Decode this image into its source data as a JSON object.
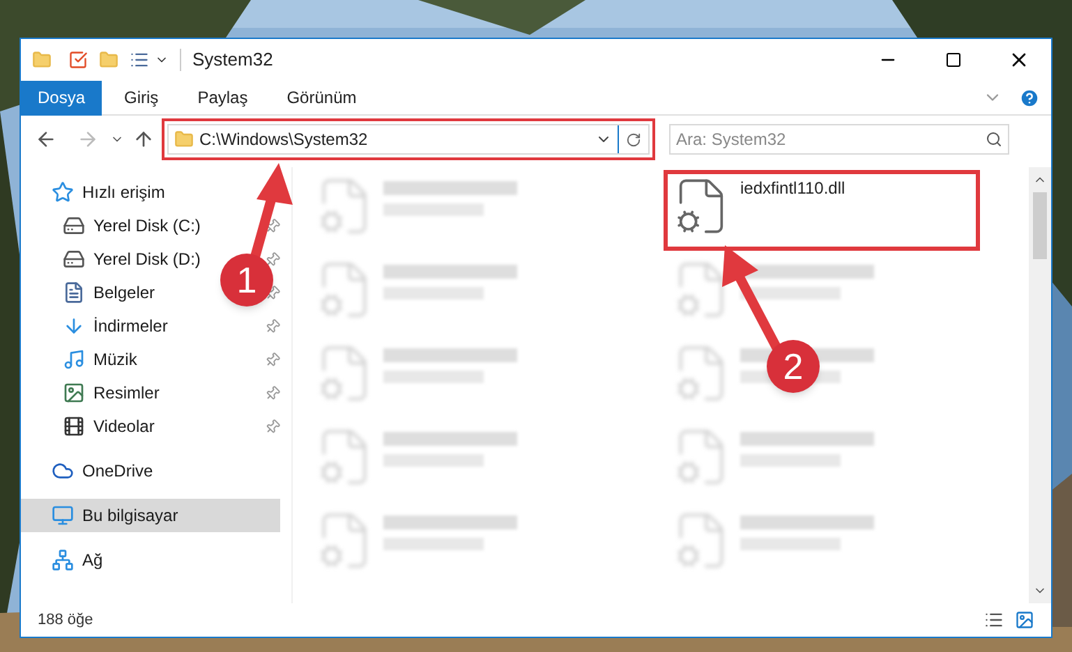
{
  "window": {
    "title": "System32"
  },
  "ribbon_tabs": [
    {
      "label": "Dosya",
      "selected": true
    },
    {
      "label": "Giriş",
      "selected": false
    },
    {
      "label": "Paylaş",
      "selected": false
    },
    {
      "label": "Görünüm",
      "selected": false
    }
  ],
  "address": {
    "path": "C:\\Windows\\System32",
    "highlighted": true
  },
  "search": {
    "placeholder": "Ara: System32"
  },
  "sidebar": {
    "groups": [
      {
        "items": [
          {
            "label": "Hızlı erişim",
            "kind": "star",
            "selected": false,
            "children": [
              {
                "label": "Yerel Disk (C:)",
                "kind": "drive",
                "selected": false,
                "pinned": true
              },
              {
                "label": "Yerel Disk (D:)",
                "kind": "drive",
                "selected": false,
                "pinned": true
              },
              {
                "label": "Belgeler",
                "kind": "documents",
                "selected": false,
                "pinned": true
              },
              {
                "label": "İndirmeler",
                "kind": "downloads",
                "selected": false,
                "pinned": true
              },
              {
                "label": "Müzik",
                "kind": "music",
                "selected": false,
                "pinned": true
              },
              {
                "label": "Resimler",
                "kind": "pictures",
                "selected": false,
                "pinned": true
              },
              {
                "label": "Videolar",
                "kind": "videos",
                "selected": false,
                "pinned": true
              }
            ]
          }
        ]
      },
      {
        "items": [
          {
            "label": "OneDrive",
            "kind": "cloud",
            "selected": false
          }
        ]
      },
      {
        "items": [
          {
            "label": "Bu bilgisayar",
            "kind": "computer",
            "selected": true
          }
        ]
      },
      {
        "items": [
          {
            "label": "Ağ",
            "kind": "network",
            "selected": false
          }
        ]
      }
    ]
  },
  "files": [
    {
      "blurred": true,
      "highlighted": false
    },
    {
      "name": "iedxfintl110.dll",
      "blurred": false,
      "highlighted": true
    },
    {
      "blurred": true,
      "highlighted": false
    },
    {
      "blurred": true,
      "highlighted": false
    },
    {
      "blurred": true,
      "highlighted": false
    },
    {
      "blurred": true,
      "highlighted": false
    },
    {
      "blurred": true,
      "highlighted": false
    },
    {
      "blurred": true,
      "highlighted": false
    },
    {
      "blurred": true,
      "highlighted": false
    },
    {
      "blurred": true,
      "highlighted": false
    }
  ],
  "status_bar": {
    "count": "188 öğe"
  },
  "annotations": [
    {
      "number": "1"
    },
    {
      "number": "2"
    }
  ]
}
